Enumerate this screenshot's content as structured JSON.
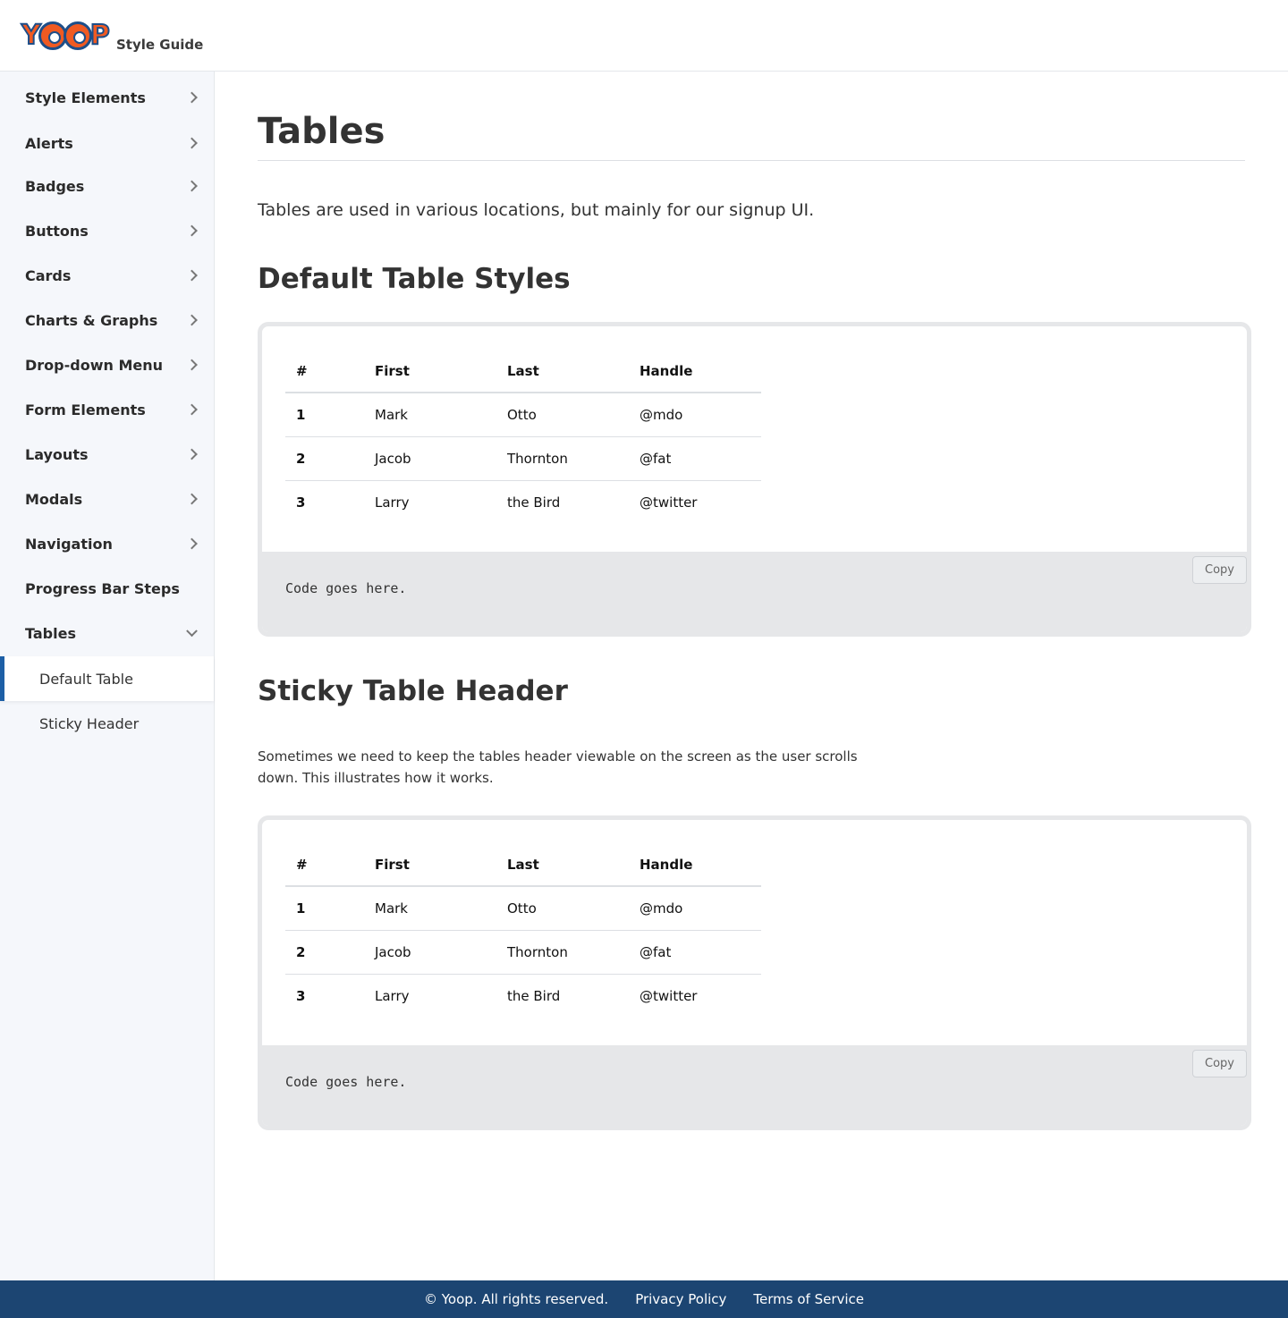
{
  "brand": {
    "logo_text": "YOOP",
    "subtitle": "Style Guide",
    "colors": {
      "orange": "#f05a22",
      "navy": "#1d4e89",
      "footer": "#1c4572",
      "active_accent": "#1d5fa6"
    }
  },
  "sidebar": {
    "items": [
      {
        "label": "Style Elements",
        "icon": "chevron-right-icon"
      },
      {
        "label": "Alerts",
        "icon": "chevron-right-icon"
      },
      {
        "label": "Badges",
        "icon": "chevron-right-icon"
      },
      {
        "label": "Buttons",
        "icon": "chevron-right-icon"
      },
      {
        "label": "Cards",
        "icon": "chevron-right-icon"
      },
      {
        "label": "Charts & Graphs",
        "icon": "chevron-right-icon"
      },
      {
        "label": "Drop-down Menu",
        "icon": "chevron-right-icon"
      },
      {
        "label": "Form Elements",
        "icon": "chevron-right-icon"
      },
      {
        "label": "Layouts",
        "icon": "chevron-right-icon"
      },
      {
        "label": "Modals",
        "icon": "chevron-right-icon"
      },
      {
        "label": "Navigation",
        "icon": "chevron-right-icon"
      },
      {
        "label": "Progress Bar Steps"
      },
      {
        "label": "Tables",
        "icon": "chevron-down-icon",
        "expanded": true
      }
    ],
    "sub_items": [
      {
        "label": "Default Table",
        "active": true
      },
      {
        "label": "Sticky Header",
        "active": false
      }
    ]
  },
  "main": {
    "title": "Tables",
    "intro": "Tables are used in various locations, but mainly for our signup UI.",
    "sections": [
      {
        "heading": "Default Table Styles",
        "code": "Code goes here.",
        "copy_label": "Copy"
      },
      {
        "heading": "Sticky Table Header",
        "description": "Sometimes we need to keep the tables header viewable on the screen as the user scrolls down. This illustrates how it works.",
        "code": "Code goes here.",
        "copy_label": "Copy"
      }
    ],
    "table": {
      "headers": [
        "#",
        "First",
        "Last",
        "Handle"
      ],
      "rows": [
        [
          "1",
          "Mark",
          "Otto",
          "@mdo"
        ],
        [
          "2",
          "Jacob",
          "Thornton",
          "@fat"
        ],
        [
          "3",
          "Larry",
          "the Bird",
          "@twitter"
        ]
      ]
    }
  },
  "footer": {
    "copyright": "© Yoop. All rights reserved.",
    "privacy": "Privacy Policy",
    "terms": "Terms of Service"
  }
}
